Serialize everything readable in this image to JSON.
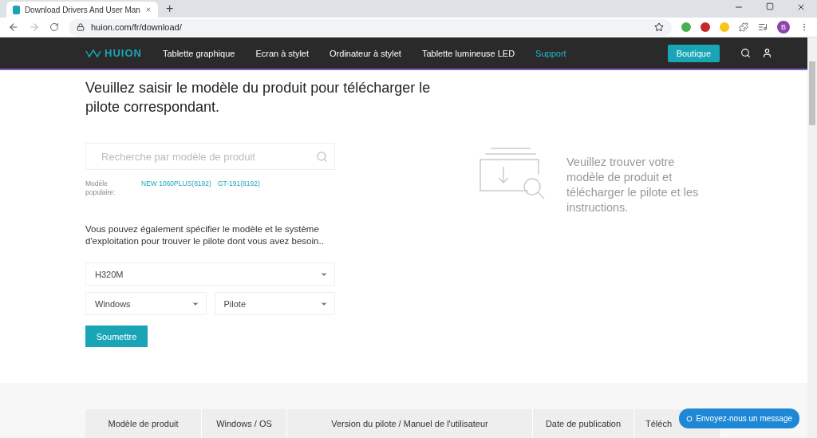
{
  "browser": {
    "tab_title": "Download Drivers And User Man",
    "new_tab": "+",
    "url": "huion.com/fr/download/",
    "profile_initial": "B"
  },
  "nav": {
    "logo": "HUION",
    "links": [
      {
        "label": "Tablette graphique",
        "selected": false
      },
      {
        "label": "Ecran à stylet",
        "selected": false
      },
      {
        "label": "Ordinateur à stylet",
        "selected": false
      },
      {
        "label": "Tablette lumineuse LED",
        "selected": false
      },
      {
        "label": "Support",
        "selected": true
      }
    ],
    "shop_button": "Boutique"
  },
  "heading": "Veuillez saisir le modèle du produit pour télécharger le pilote correspondant.",
  "search": {
    "placeholder": "Recherche par modèle de produit"
  },
  "popular": {
    "label": "Modèle populaire:",
    "models": [
      "NEW 1060PLUS(8192)",
      "GT-191(8192)"
    ]
  },
  "hint": "Vous pouvez également spécifier le modèle et le système d'exploitation pour trouver le pilote dont vous avez besoin..",
  "selects": {
    "model": "H320M",
    "os": "Windows",
    "type": "Pilote"
  },
  "submit": "Soumettre",
  "empty_state": "Veuillez trouver votre modèle de produit et télécharger le pilote et les instructions.",
  "table": {
    "columns": [
      "Modèle de produit",
      "Windows / OS",
      "Version du pilote / Manuel de l'utilisateur",
      "Date de publication",
      "Téléch"
    ]
  },
  "chat_button": "Envoyez-nous un message"
}
